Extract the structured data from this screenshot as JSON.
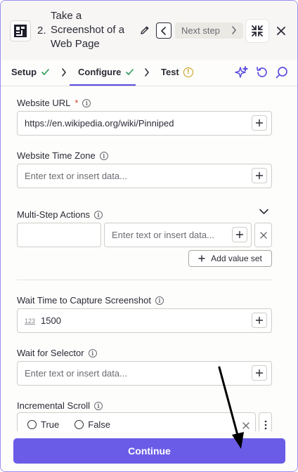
{
  "header": {
    "step_number": "2.",
    "step_title": "Take a Screenshot of a Web Page",
    "next_step_label": "Next step"
  },
  "tabs": [
    {
      "label": "Setup",
      "status": "complete"
    },
    {
      "label": "Configure",
      "status": "complete",
      "active": true
    },
    {
      "label": "Test",
      "status": "warning"
    }
  ],
  "tab_icons": [
    "sparkle-icon",
    "refresh-icon",
    "search-icon"
  ],
  "fields": {
    "website_url": {
      "label": "Website URL",
      "required_mark": "*",
      "value": "https://en.wikipedia.org/wiki/Pinniped"
    },
    "website_time_zone": {
      "label": "Website Time Zone",
      "placeholder": "Enter text or insert data..."
    },
    "multi_step_actions": {
      "label": "Multi-Step Actions",
      "value_placeholder": "Enter text or insert data...",
      "add_label": "Add value set"
    },
    "wait_time": {
      "label": "Wait Time to Capture Screenshot",
      "type_badge": "123",
      "value": "1500"
    },
    "wait_for_selector": {
      "label": "Wait for Selector",
      "placeholder": "Enter text or insert data..."
    },
    "incremental_scroll": {
      "label": "Incremental Scroll",
      "options": [
        "True",
        "False"
      ]
    }
  },
  "footer": {
    "continue_label": "Continue"
  },
  "colors": {
    "accent": "#6b5ce7",
    "success": "#2e9a5c",
    "warning": "#c79a10",
    "required": "#d2452b"
  }
}
